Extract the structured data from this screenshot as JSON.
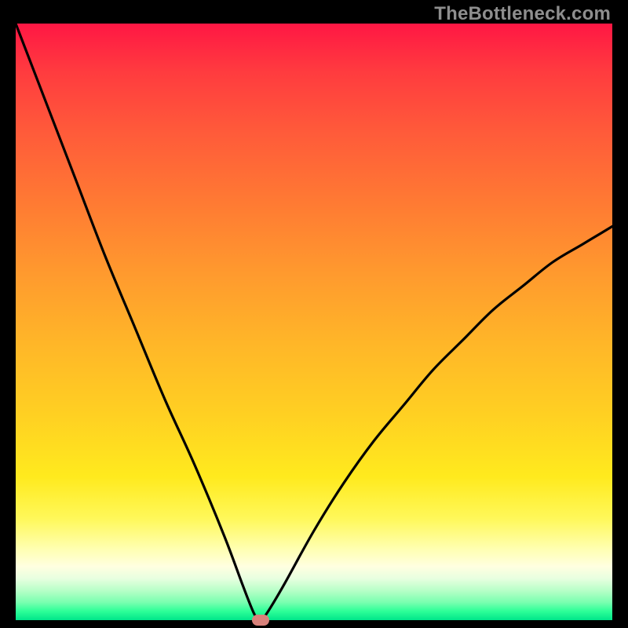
{
  "watermark": "TheBottleneck.com",
  "chart_data": {
    "type": "line",
    "title": "",
    "xlabel": "",
    "ylabel": "",
    "xlim": [
      0,
      100
    ],
    "ylim": [
      0,
      100
    ],
    "legend": false,
    "grid": false,
    "background_gradient": {
      "top": "#ff1744",
      "mid": "#ffe81e",
      "bottom": "#00e58a"
    },
    "series": [
      {
        "name": "bottleneck-curve",
        "color": "#000000",
        "x": [
          0,
          5,
          10,
          15,
          20,
          25,
          30,
          35,
          38,
          40,
          41,
          42,
          45,
          50,
          55,
          60,
          65,
          70,
          75,
          80,
          85,
          90,
          95,
          100
        ],
        "y": [
          100,
          87,
          74,
          61,
          49,
          37,
          26,
          14,
          6,
          1,
          0,
          1,
          6,
          15,
          23,
          30,
          36,
          42,
          47,
          52,
          56,
          60,
          63,
          66
        ]
      }
    ],
    "marker": {
      "name": "optimal-point",
      "x": 41,
      "y": 0,
      "color": "#d9827b"
    }
  }
}
